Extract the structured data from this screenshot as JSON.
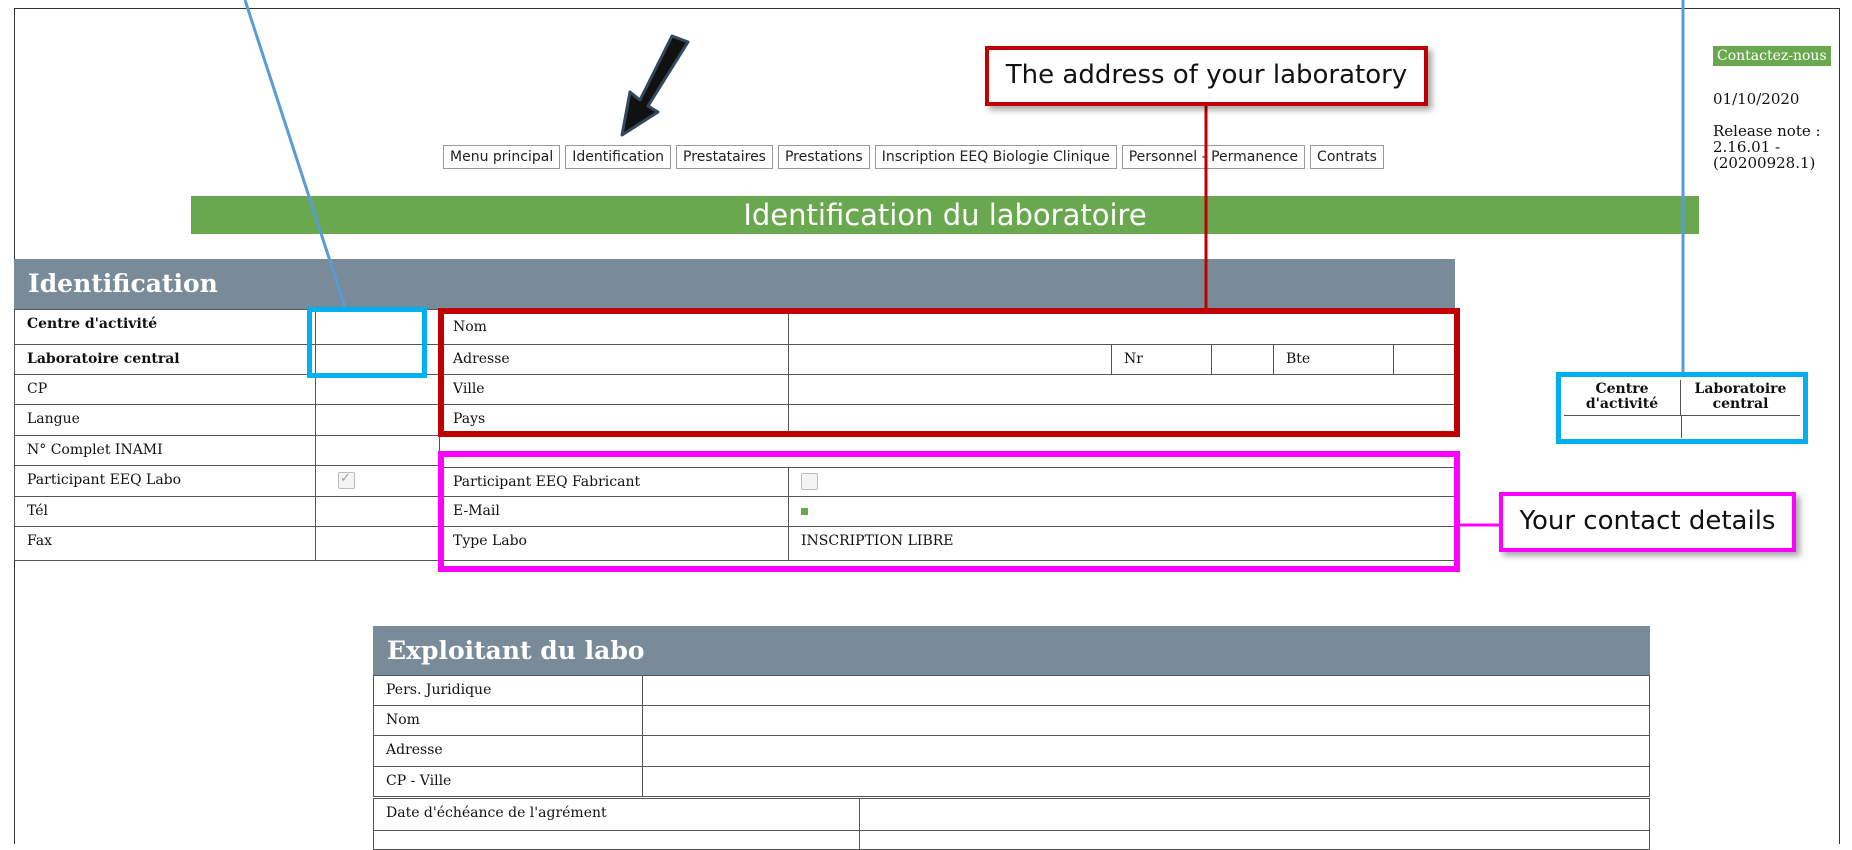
{
  "nav": {
    "items": [
      "Menu principal",
      "Identification",
      "Prestataires",
      "Prestations",
      "Inscription EEQ Biologie Clinique",
      "Personnel - Permanence",
      "Contrats"
    ]
  },
  "banner_title": "Identification du laboratoire",
  "side": {
    "contact_label": "Contactez-nous",
    "date": "01/10/2020",
    "release_note": "Release note :\n2.16.01 -\n(20200928.1)"
  },
  "identification": {
    "header": "Identification",
    "left_labels": [
      "Centre d'activité",
      "Laboratoire central",
      "CP",
      "Langue",
      "N° Complet INAMI",
      "Participant EEQ Labo",
      "Tél",
      "Fax"
    ],
    "address_labels": [
      "Nom",
      "Adresse",
      "Ville",
      "Pays"
    ],
    "nr_label": "Nr",
    "bte_label": "Bte",
    "contact_labels": [
      "Participant EEQ Fabricant",
      "E-Mail",
      "Type Labo"
    ],
    "type_labo_value": "INSCRIPTION LIBRE",
    "participant_eeq_labo_checked": true,
    "participant_eeq_fabricant_checked": false
  },
  "exploitant": {
    "header": "Exploitant du labo",
    "labels": [
      "Pers. Juridique",
      "Nom",
      "Adresse",
      "CP - Ville"
    ],
    "extra_label": "Date d'échéance de l'agrément"
  },
  "side_table": {
    "col1": "Centre d'activité",
    "col2": "Laboratoire central"
  },
  "annotations": {
    "address_callout": "The address of your laboratory",
    "contact_callout": "Your contact details",
    "colors": {
      "red": "#c00000",
      "blue": "#00b0f0",
      "magenta": "#ff00ff",
      "arrow": "#1f2d3d"
    }
  }
}
